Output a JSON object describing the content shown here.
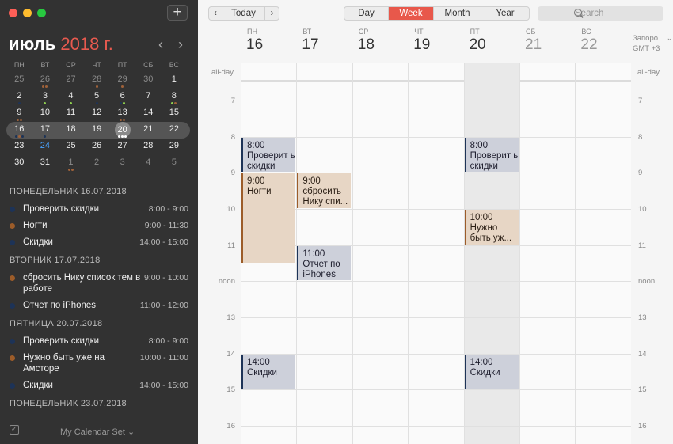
{
  "window": {
    "colors": {
      "close": "#fd5f57",
      "min": "#febc2e",
      "max": "#28c840"
    }
  },
  "sidebar": {
    "add_label": "+",
    "month": "июль",
    "year": "2018 г.",
    "prev": "‹",
    "next": "›",
    "dow": [
      "ПН",
      "ВТ",
      "СР",
      "ЧТ",
      "ПТ",
      "СБ",
      "ВС"
    ],
    "weeks": [
      [
        {
          "d": "25",
          "o": true
        },
        {
          "d": "26",
          "o": true,
          "dots": [
            "#a0623a",
            "#a0623a"
          ]
        },
        {
          "d": "27",
          "o": true
        },
        {
          "d": "28",
          "o": true,
          "dots": [
            "#a0623a"
          ]
        },
        {
          "d": "29",
          "o": true,
          "dots": [
            "#a0623a"
          ]
        },
        {
          "d": "30",
          "o": true
        },
        {
          "d": "1"
        }
      ],
      [
        {
          "d": "2",
          "dots": [
            "#1d3357"
          ]
        },
        {
          "d": "3",
          "dots": [
            "#8fd14f"
          ]
        },
        {
          "d": "4",
          "dots": [
            "#8fd14f"
          ]
        },
        {
          "d": "5",
          "dots": [
            "#1d3357"
          ]
        },
        {
          "d": "6",
          "dots": [
            "#1d3357",
            "#8fd14f"
          ]
        },
        {
          "d": "7"
        },
        {
          "d": "8",
          "dots": [
            "#8fd14f",
            "#a0623a"
          ]
        }
      ],
      [
        {
          "d": "9",
          "dots": [
            "#a0623a",
            "#a0623a"
          ]
        },
        {
          "d": "10"
        },
        {
          "d": "11"
        },
        {
          "d": "12"
        },
        {
          "d": "13",
          "dots": [
            "#a0623a",
            "#a0623a"
          ]
        },
        {
          "d": "14"
        },
        {
          "d": "15"
        }
      ],
      [
        {
          "d": "16",
          "dots": [
            "#1d3357",
            "#a0623a",
            "#1d3357"
          ]
        },
        {
          "d": "17",
          "dots": [
            "#1d3357"
          ]
        },
        {
          "d": "18"
        },
        {
          "d": "19"
        },
        {
          "d": "20",
          "today": true,
          "dots": [
            "#ffffff",
            "#ffffff",
            "#ffffff"
          ]
        },
        {
          "d": "21"
        },
        {
          "d": "22"
        }
      ],
      [
        {
          "d": "23"
        },
        {
          "d": "24",
          "blue": true
        },
        {
          "d": "25"
        },
        {
          "d": "26"
        },
        {
          "d": "27"
        },
        {
          "d": "28"
        },
        {
          "d": "29"
        }
      ],
      [
        {
          "d": "30"
        },
        {
          "d": "31"
        },
        {
          "d": "1",
          "o": true,
          "dots": [
            "#a0623a",
            "#a0623a"
          ]
        },
        {
          "d": "2",
          "o": true
        },
        {
          "d": "3",
          "o": true
        },
        {
          "d": "4",
          "o": true
        },
        {
          "d": "5",
          "o": true
        }
      ]
    ],
    "agenda": [
      {
        "head": "ПОНЕДЕЛЬНИК 16.07.2018",
        "items": [
          {
            "title": "Проверить скидки",
            "time": "8:00 - 9:00",
            "color": "#1d3357"
          },
          {
            "title": "Ногти",
            "time": "9:00 - 11:30",
            "color": "#9c5c29"
          },
          {
            "title": "Скидки",
            "time": "14:00 - 15:00",
            "color": "#1d3357"
          }
        ]
      },
      {
        "head": "ВТОРНИК 17.07.2018",
        "items": [
          {
            "title": "сбросить Нику список тем в работе",
            "time": "9:00 - 10:00",
            "color": "#9c5c29"
          },
          {
            "title": "Отчет по iPhones",
            "time": "11:00 - 12:00",
            "color": "#1d3357"
          }
        ]
      },
      {
        "head": "ПЯТНИЦА 20.07.2018",
        "items": [
          {
            "title": "Проверить скидки",
            "time": "8:00 - 9:00",
            "color": "#1d3357"
          },
          {
            "title": "Нужно быть уже на Амсторе",
            "time": "10:00 - 11:00",
            "color": "#9c5c29"
          },
          {
            "title": "Скидки",
            "time": "14:00 - 15:00",
            "color": "#1d3357"
          }
        ]
      },
      {
        "head": "ПОНЕДЕЛЬНИК 23.07.2018",
        "items": []
      }
    ],
    "calendar_set": "My Calendar Set ⌄"
  },
  "toolbar": {
    "prev": "‹",
    "today": "Today",
    "next": "›",
    "views": [
      "Day",
      "Week",
      "Month",
      "Year"
    ],
    "active_view": "Week",
    "search_placeholder": "Search",
    "timezone_line1": "Запоро... ⌄",
    "timezone_line2": "GMT +3"
  },
  "week": {
    "days": [
      {
        "dow": "ПН",
        "num": "16"
      },
      {
        "dow": "ВТ",
        "num": "17"
      },
      {
        "dow": "СР",
        "num": "18"
      },
      {
        "dow": "ЧТ",
        "num": "19"
      },
      {
        "dow": "ПТ",
        "num": "20"
      },
      {
        "dow": "СБ",
        "num": "21"
      },
      {
        "dow": "ВС",
        "num": "22"
      }
    ],
    "all_day_label": "all-day",
    "hours": [
      "7",
      "8",
      "9",
      "10",
      "11",
      "noon",
      "13",
      "14",
      "15",
      "16"
    ],
    "events": [
      {
        "day": 0,
        "start": 8,
        "end": 9,
        "time": "8:00",
        "title": "Проверит ь скидки",
        "kind": "blue"
      },
      {
        "day": 0,
        "start": 9,
        "end": 11.5,
        "time": "9:00",
        "title": "Ногти",
        "kind": "tan"
      },
      {
        "day": 1,
        "start": 9,
        "end": 10,
        "time": "9:00",
        "title": "сбросить Нику спи...",
        "kind": "tan"
      },
      {
        "day": 1,
        "start": 11,
        "end": 12,
        "time": "11:00",
        "title": "Отчет по iPhones",
        "kind": "blue"
      },
      {
        "day": 4,
        "start": 8,
        "end": 9,
        "time": "8:00",
        "title": "Проверит ь скидки",
        "kind": "blue"
      },
      {
        "day": 4,
        "start": 10,
        "end": 11,
        "time": "10:00",
        "title": "Нужно быть уж...",
        "kind": "tan"
      },
      {
        "day": 0,
        "start": 14,
        "end": 15,
        "time": "14:00",
        "title": "Скидки",
        "kind": "blue"
      },
      {
        "day": 4,
        "start": 14,
        "end": 15,
        "time": "14:00",
        "title": "Скидки",
        "kind": "blue"
      }
    ]
  }
}
